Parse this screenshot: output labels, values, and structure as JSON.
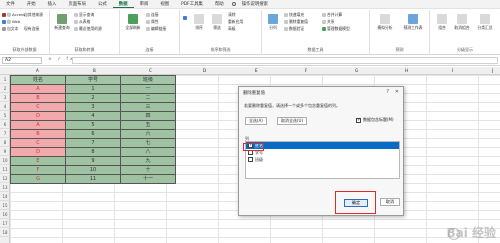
{
  "ribbon_tabs": [
    "文件",
    "开始",
    "插入",
    "页面布局",
    "公式",
    "数据",
    "审阅",
    "视图",
    "PDF工具集",
    "帮助",
    "操作说明搜索"
  ],
  "ribbon": {
    "external": {
      "items": [
        "自 Access",
        "自 Web",
        "自文本",
        "自其他来源",
        "现有连接"
      ],
      "label": "获取外部数据"
    },
    "transform": {
      "big": "新建查询",
      "items": [
        "显示查询",
        "从表格",
        "最近使用的源"
      ],
      "label": "获取和转换"
    },
    "connections": {
      "big": "全部刷新",
      "items": [
        "连接",
        "属性",
        "编辑链接"
      ],
      "label": "连接"
    },
    "sort": {
      "items": [
        "排序",
        "筛选",
        "清除",
        "重新应用",
        "高级"
      ],
      "label": "排序和筛选"
    },
    "tools": {
      "items": [
        "分列",
        "快速填充",
        "删除重复值",
        "数据验证",
        "合并计算",
        "关系",
        "管理数据模型"
      ],
      "label": "数据工具"
    },
    "forecast": {
      "items": [
        "模拟分析",
        "预测工作表"
      ],
      "label": "预测"
    },
    "outline": {
      "items": [
        "组合",
        "取消组合",
        "分类汇总"
      ],
      "label": "分级显示"
    }
  },
  "formula_bar": {
    "cell": "A2",
    "fx": "× ✓ fx"
  },
  "columns": [
    "A",
    "B",
    "C",
    "D",
    "E",
    "F",
    "G",
    "H",
    "I",
    "J"
  ],
  "rows": [
    "1",
    "2",
    "3",
    "4",
    "5",
    "6",
    "7",
    "8",
    "9",
    "10",
    "11",
    "12",
    "13",
    "14",
    "15",
    "16",
    "17",
    "18"
  ],
  "table": {
    "headers": [
      "姓名",
      "学号",
      "班级"
    ],
    "rows": [
      {
        "name": "A",
        "id": "1",
        "cls": "一"
      },
      {
        "name": "B",
        "id": "2",
        "cls": "二"
      },
      {
        "name": "C",
        "id": "3",
        "cls": "三"
      },
      {
        "name": "D",
        "id": "4",
        "cls": "四"
      },
      {
        "name": "A",
        "id": "5",
        "cls": "五"
      },
      {
        "name": "B",
        "id": "6",
        "cls": "六"
      },
      {
        "name": "C",
        "id": "7",
        "cls": "七"
      },
      {
        "name": "D",
        "id": "8",
        "cls": "八"
      },
      {
        "name": "E",
        "id": "9",
        "cls": "九"
      },
      {
        "name": "F",
        "id": "10",
        "cls": "十"
      },
      {
        "name": "G",
        "id": "11",
        "cls": "十一"
      }
    ]
  },
  "dialog": {
    "title": "删除重复值",
    "help": "?",
    "close": "✕",
    "desc": "若要删除重复值，请选择一个或多个包含重复值的列。",
    "select_all": "全选(A)",
    "unselect_all": "取消全选(U)",
    "has_header": "数据包含标题(M)",
    "columns_head": "列",
    "columns": [
      {
        "label": "姓名",
        "checked": true
      },
      {
        "label": "学号",
        "checked": false
      },
      {
        "label": "班级",
        "checked": false
      }
    ],
    "ok": "确定",
    "cancel": "取消"
  },
  "watermark": "Bai 经验"
}
